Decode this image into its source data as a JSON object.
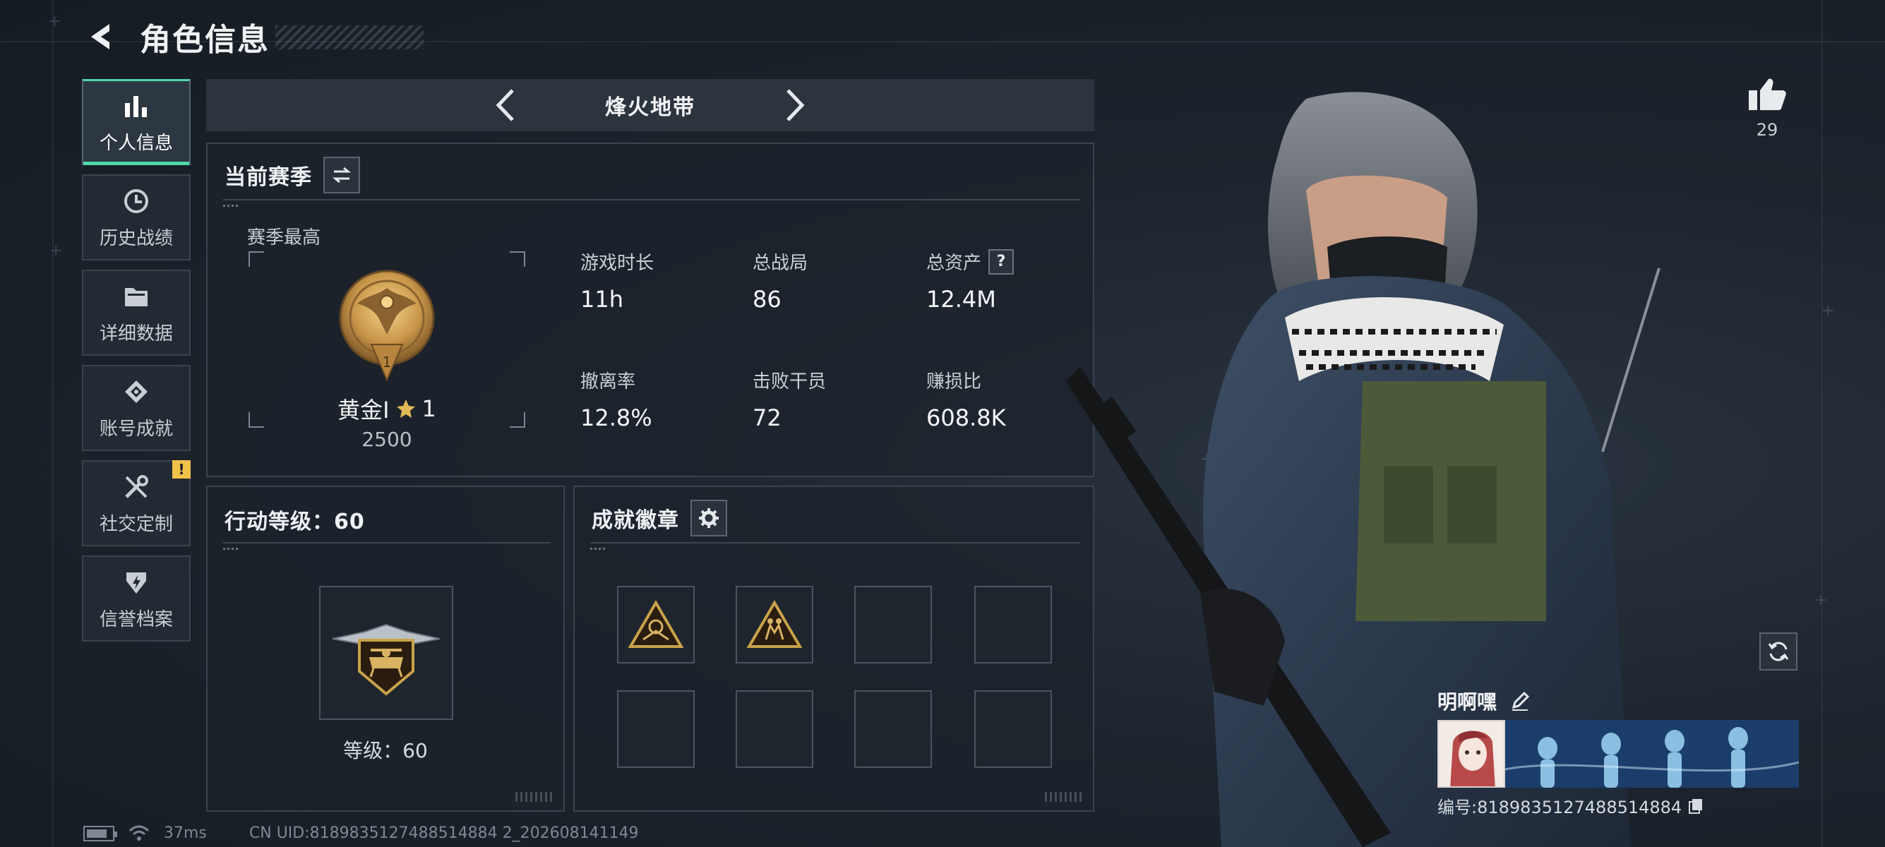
{
  "header": {
    "title": "角色信息"
  },
  "sidebar": {
    "items": [
      {
        "label": "个人信息",
        "active": true
      },
      {
        "label": "历史战绩"
      },
      {
        "label": "详细数据"
      },
      {
        "label": "账号成就"
      },
      {
        "label": "社交定制",
        "badge": "!"
      },
      {
        "label": "信誉档案"
      }
    ]
  },
  "mode": {
    "title": "烽火地带"
  },
  "season": {
    "title": "当前赛季",
    "best_label": "赛季最高",
    "rank_name": "黄金Ⅰ",
    "rank_stars": "1",
    "rank_score": "2500",
    "stats": [
      {
        "label": "游戏时长",
        "value": "11h"
      },
      {
        "label": "总战局",
        "value": "86"
      },
      {
        "label": "总资产",
        "value": "12.4M",
        "help": "?"
      },
      {
        "label": "撤离率",
        "value": "12.8%"
      },
      {
        "label": "击败干员",
        "value": "72"
      },
      {
        "label": "赚损比",
        "value": "608.8K"
      }
    ]
  },
  "level": {
    "title": "行动等级：60",
    "level_text": "等级：60"
  },
  "badges": {
    "title": "成就徽章"
  },
  "likes": {
    "count": "29"
  },
  "player": {
    "name": "明啊嘿",
    "id_text": "编号:8189835127488514884"
  },
  "footer": {
    "ping": "37ms",
    "uid": "CN UID:8189835127488514884 2_202608141149"
  },
  "colors": {
    "accent": "#4ed8a8",
    "gold": "#c9a24a",
    "warning": "#f2c14a"
  }
}
